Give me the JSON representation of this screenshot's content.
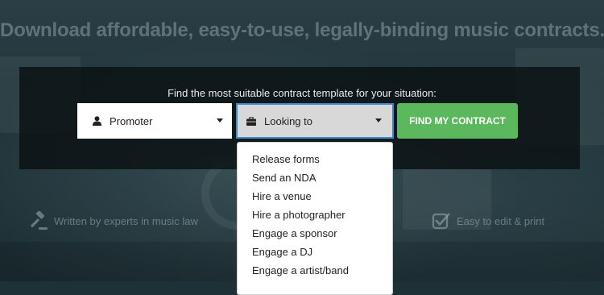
{
  "headline": "Download affordable, easy-to-use, legally-binding music contracts.",
  "search": {
    "caption": "Find the most suitable contract template for your situation:",
    "who_select": {
      "value": "Promoter",
      "icon": "user-icon"
    },
    "need_select": {
      "value": "Looking to",
      "icon": "briefcase-icon"
    },
    "find_button": "FIND MY CONTRACT",
    "dropdown_options": [
      "Release forms",
      "Send an NDA",
      "Hire a venue",
      "Hire a photographer",
      "Engage a sponsor",
      "Engage a DJ",
      "Engage a artist/band"
    ]
  },
  "features": {
    "left": {
      "text": "Written by experts in music law",
      "icon": "gavel-icon"
    },
    "right": {
      "text": "Easy to edit & print",
      "icon": "checkbox-icon"
    }
  },
  "colors": {
    "button_green": "#5cb85c",
    "focus_blue": "#3a8bd0",
    "panel_dark": "#0a1012"
  }
}
